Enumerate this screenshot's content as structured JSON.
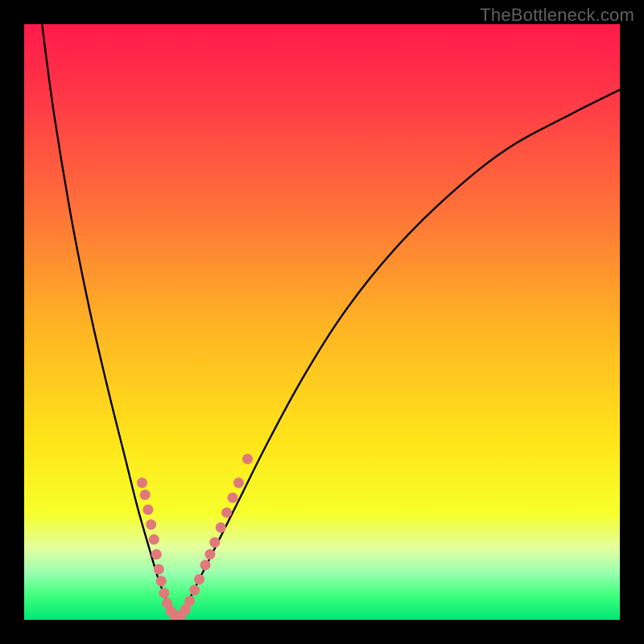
{
  "watermark": "TheBottleneck.com",
  "chart_data": {
    "type": "line",
    "title": "",
    "xlabel": "",
    "ylabel": "",
    "xlim": [
      0,
      100
    ],
    "ylim": [
      0,
      100
    ],
    "grid": false,
    "legend": false,
    "background_gradient_stops": [
      {
        "offset": 0.0,
        "color": "#ff1a4b"
      },
      {
        "offset": 0.12,
        "color": "#ff3747"
      },
      {
        "offset": 0.3,
        "color": "#ff6e3a"
      },
      {
        "offset": 0.5,
        "color": "#ffb224"
      },
      {
        "offset": 0.7,
        "color": "#ffe51a"
      },
      {
        "offset": 0.82,
        "color": "#f7ff2a"
      },
      {
        "offset": 0.88,
        "color": "#e2ffa0"
      },
      {
        "offset": 0.92,
        "color": "#9cffb0"
      },
      {
        "offset": 0.96,
        "color": "#3dff7d"
      },
      {
        "offset": 1.0,
        "color": "#00e676"
      }
    ],
    "series": [
      {
        "name": "left-branch",
        "x": [
          3,
          5,
          8,
          11,
          14,
          17,
          19,
          21,
          22.5,
          24,
          25,
          25.8
        ],
        "y": [
          100,
          85,
          67,
          52,
          39,
          27,
          19,
          12,
          7,
          3,
          1,
          0
        ]
      },
      {
        "name": "right-branch",
        "x": [
          25.8,
          27,
          29,
          32,
          36,
          41,
          47,
          54,
          62,
          71,
          81,
          92,
          100
        ],
        "y": [
          0,
          2,
          6,
          12,
          20,
          30,
          41,
          52,
          62,
          71,
          79,
          85,
          89
        ]
      }
    ],
    "scatter": {
      "name": "dots",
      "color": "#e07a7a",
      "points": [
        {
          "x": 19.8,
          "y": 23
        },
        {
          "x": 20.3,
          "y": 21
        },
        {
          "x": 20.8,
          "y": 18.5
        },
        {
          "x": 21.3,
          "y": 16
        },
        {
          "x": 21.8,
          "y": 13.5
        },
        {
          "x": 22.2,
          "y": 11
        },
        {
          "x": 22.6,
          "y": 8.5
        },
        {
          "x": 23.0,
          "y": 6.5
        },
        {
          "x": 23.5,
          "y": 4.5
        },
        {
          "x": 24.0,
          "y": 2.8
        },
        {
          "x": 24.6,
          "y": 1.5
        },
        {
          "x": 25.2,
          "y": 0.8
        },
        {
          "x": 25.8,
          "y": 0.5
        },
        {
          "x": 26.4,
          "y": 0.8
        },
        {
          "x": 27.1,
          "y": 1.8
        },
        {
          "x": 27.8,
          "y": 3.2
        },
        {
          "x": 28.6,
          "y": 5.0
        },
        {
          "x": 29.4,
          "y": 6.8
        },
        {
          "x": 30.4,
          "y": 9.2
        },
        {
          "x": 31.2,
          "y": 11.0
        },
        {
          "x": 32.0,
          "y": 13.0
        },
        {
          "x": 33.0,
          "y": 15.5
        },
        {
          "x": 34.0,
          "y": 18.0
        },
        {
          "x": 35.0,
          "y": 20.5
        },
        {
          "x": 36.0,
          "y": 23.0
        },
        {
          "x": 37.5,
          "y": 27.0
        }
      ]
    }
  }
}
